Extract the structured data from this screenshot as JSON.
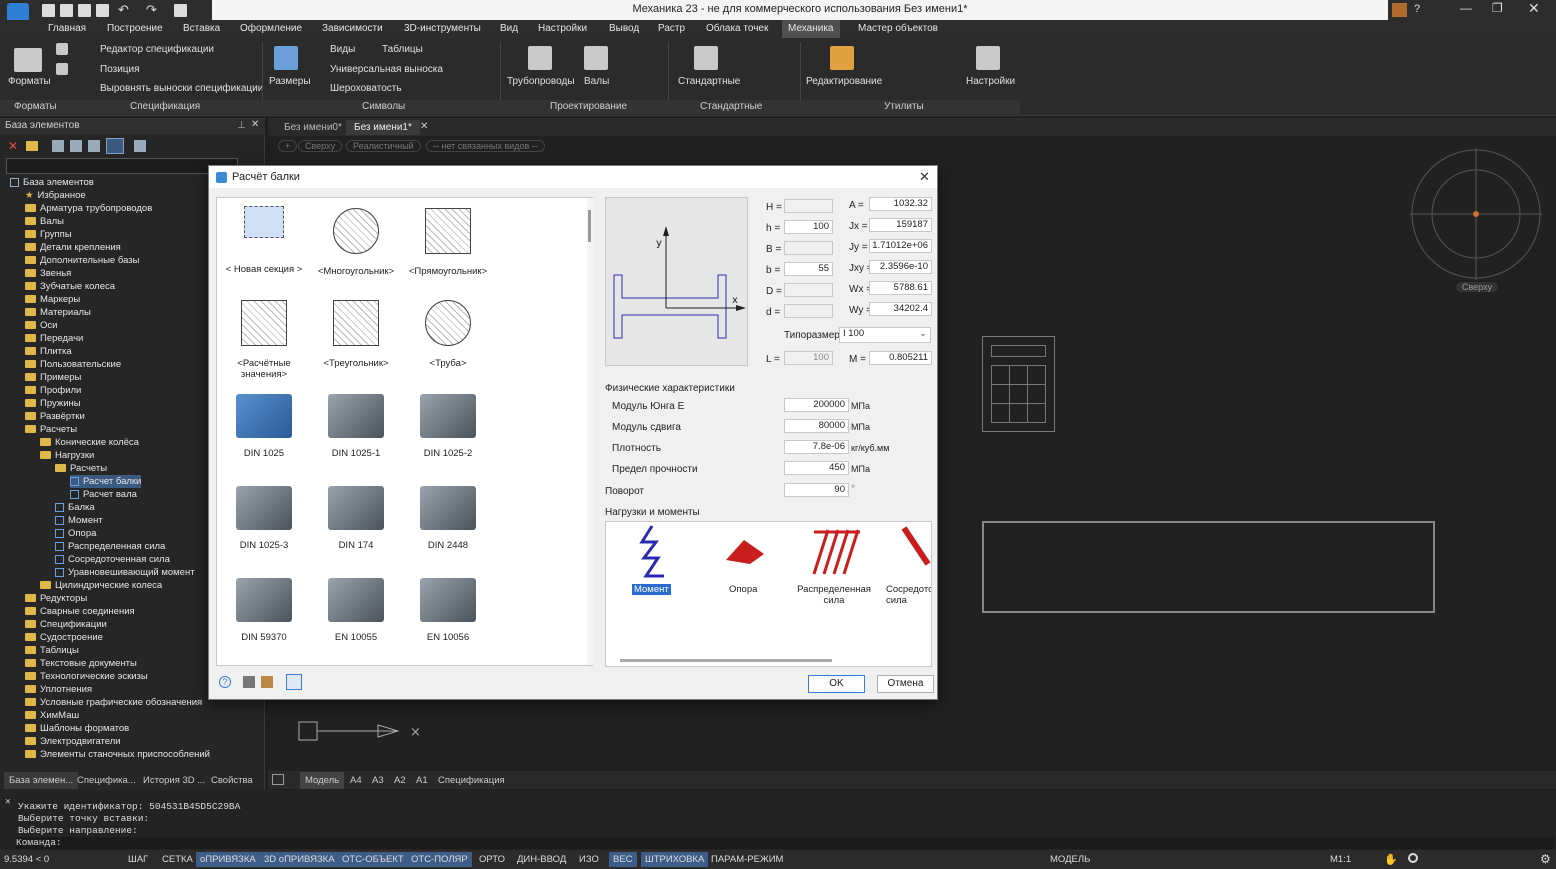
{
  "app": {
    "title": "Механика 23 - не для коммерческого использования Без имени1*"
  },
  "menu": [
    "Главная",
    "Построение",
    "Вставка",
    "Оформление",
    "Зависимости",
    "3D-инструменты",
    "Вид",
    "Настройки",
    "Вывод",
    "Растр",
    "Облака точек",
    "Механика",
    "Мастер объектов"
  ],
  "ribbon": {
    "formats": "Форматы",
    "spec_editor": "Редактор спецификации",
    "position": "Позиция",
    "align_spec": "Выровнять выноски спецификации",
    "sizes": "Размеры",
    "views": "Виды",
    "tables": "Таблицы",
    "universal_leader": "Универсальная выноска",
    "roughness": "Шероховатость",
    "pipelines": "Трубопроводы",
    "shafts": "Валы",
    "standard": "Стандартные",
    "editing": "Редактирование",
    "settings": "Настройки",
    "groups": [
      "Форматы",
      "Спецификация",
      "Символы",
      "Проектирование",
      "Стандартные",
      "Утилиты"
    ]
  },
  "left_panel": {
    "header": "База элементов",
    "tree": [
      {
        "label": "База элементов",
        "level": 0,
        "type": "root"
      },
      {
        "label": "Избранное",
        "level": 1,
        "type": "star"
      },
      {
        "label": "Арматура трубопроводов",
        "level": 1,
        "type": "folder"
      },
      {
        "label": "Валы",
        "level": 1,
        "type": "folder"
      },
      {
        "label": "Группы",
        "level": 1,
        "type": "folder"
      },
      {
        "label": "Детали крепления",
        "level": 1,
        "type": "folder"
      },
      {
        "label": "Дополнительные базы",
        "level": 1,
        "type": "folder"
      },
      {
        "label": "Звенья",
        "level": 1,
        "type": "folder"
      },
      {
        "label": "Зубчатые колеса",
        "level": 1,
        "type": "folder"
      },
      {
        "label": "Маркеры",
        "level": 1,
        "type": "folder"
      },
      {
        "label": "Материалы",
        "level": 1,
        "type": "folder"
      },
      {
        "label": "Оси",
        "level": 1,
        "type": "folder"
      },
      {
        "label": "Передачи",
        "level": 1,
        "type": "folder"
      },
      {
        "label": "Плитка",
        "level": 1,
        "type": "folder"
      },
      {
        "label": "Пользовательские",
        "level": 1,
        "type": "folder"
      },
      {
        "label": "Примеры",
        "level": 1,
        "type": "folder"
      },
      {
        "label": "Профили",
        "level": 1,
        "type": "folder"
      },
      {
        "label": "Пружины",
        "level": 1,
        "type": "folder"
      },
      {
        "label": "Развёртки",
        "level": 1,
        "type": "folder"
      },
      {
        "label": "Расчеты",
        "level": 1,
        "type": "folder"
      },
      {
        "label": "Конические колёса",
        "level": 2,
        "type": "folder"
      },
      {
        "label": "Нагрузки",
        "level": 2,
        "type": "folder"
      },
      {
        "label": "Расчеты",
        "level": 3,
        "type": "folder"
      },
      {
        "label": "Расчет балки",
        "level": 4,
        "type": "leaf",
        "selected": true
      },
      {
        "label": "Расчет вала",
        "level": 4,
        "type": "leaf"
      },
      {
        "label": "Балка",
        "level": 3,
        "type": "leaf"
      },
      {
        "label": "Момент",
        "level": 3,
        "type": "leaf"
      },
      {
        "label": "Опора",
        "level": 3,
        "type": "leaf"
      },
      {
        "label": "Распределенная сила",
        "level": 3,
        "type": "leaf"
      },
      {
        "label": "Сосредоточенная сила",
        "level": 3,
        "type": "leaf"
      },
      {
        "label": "Уравновешивающий момент",
        "level": 3,
        "type": "leaf"
      },
      {
        "label": "Цилиндрические колеса",
        "level": 2,
        "type": "folder"
      },
      {
        "label": "Редукторы",
        "level": 1,
        "type": "folder"
      },
      {
        "label": "Сварные соединения",
        "level": 1,
        "type": "folder"
      },
      {
        "label": "Спецификации",
        "level": 1,
        "type": "folder"
      },
      {
        "label": "Судостроение",
        "level": 1,
        "type": "folder"
      },
      {
        "label": "Таблицы",
        "level": 1,
        "type": "folder"
      },
      {
        "label": "Текстовые документы",
        "level": 1,
        "type": "folder"
      },
      {
        "label": "Технологические эскизы",
        "level": 1,
        "type": "folder"
      },
      {
        "label": "Уплотнения",
        "level": 1,
        "type": "folder"
      },
      {
        "label": "Условные графические обозначения",
        "level": 1,
        "type": "folder"
      },
      {
        "label": "ХимМаш",
        "level": 1,
        "type": "folder"
      },
      {
        "label": "Шаблоны форматов",
        "level": 1,
        "type": "folder"
      },
      {
        "label": "Электродвигатели",
        "level": 1,
        "type": "folder"
      },
      {
        "label": "Элементы станочных приспособлений",
        "level": 1,
        "type": "folder"
      }
    ],
    "bottom_tabs": [
      "База элемен...",
      "Специфика...",
      "История 3D ...",
      "Свойства"
    ]
  },
  "doc_tabs": [
    "Без имени0*",
    "Без имени1*"
  ],
  "viewport": {
    "buttons": [
      "+",
      "Сверху",
      "Реалистичный",
      "-- нет связанных видов --"
    ],
    "compass_label": "Сверху"
  },
  "layout_tabs": [
    "Модель",
    "A4",
    "A3",
    "A2",
    "A1",
    "Спецификация"
  ],
  "dialog": {
    "title": "Расчёт балки",
    "gallery": [
      "< Новая секция >",
      "<Многоугольник>",
      "<Прямоугольник>",
      "<Расчётные значения>",
      "<Треугольник>",
      "<Труба>",
      "DIN 1025",
      "DIN 1025-1",
      "DIN 1025-2",
      "DIN 1025-3",
      "DIN 174",
      "DIN 2448",
      "DIN 59370",
      "EN 10055",
      "EN 10056"
    ],
    "left_params": [
      {
        "label": "H =",
        "value": ""
      },
      {
        "label": "h =",
        "value": "100"
      },
      {
        "label": "B =",
        "value": ""
      },
      {
        "label": "b =",
        "value": "55"
      },
      {
        "label": "D =",
        "value": ""
      },
      {
        "label": "d =",
        "value": ""
      }
    ],
    "right_params": [
      {
        "label": "A =",
        "value": "1032.32"
      },
      {
        "label": "Jx =",
        "value": "159187"
      },
      {
        "label": "Jy =",
        "value": "1.71012e+06"
      },
      {
        "label": "Jxy =",
        "value": "2.3596e-10"
      },
      {
        "label": "Wx =",
        "value": "5788.61"
      },
      {
        "label": "Wy =",
        "value": "34202.4"
      }
    ],
    "typesize_label": "Типоразмер",
    "typesize_value": "I 100",
    "L_label": "L =",
    "L_value": "100",
    "M_label": "M =",
    "M_value": "0.805211",
    "phys_title": "Физические характеристики",
    "phys": [
      {
        "label": "Модуль Юнга Е",
        "value": "200000",
        "unit": "МПа"
      },
      {
        "label": "Модуль сдвига",
        "value": "80000",
        "unit": "МПа"
      },
      {
        "label": "Плотность",
        "value": "7.8e-06",
        "unit": "кг/куб.мм"
      },
      {
        "label": "Предел прочности",
        "value": "450",
        "unit": "МПа"
      }
    ],
    "rotation_label": "Поворот",
    "rotation_value": "90",
    "rotation_unit": "°",
    "loads_title": "Нагрузки и моменты",
    "loads": [
      "Момент",
      "Опора",
      "Распределенная сила",
      "Сосредоточенная сила"
    ],
    "ok": "OK",
    "cancel": "Отмена"
  },
  "command": {
    "lines": [
      "Укажите идентификатор: 504531B45D5C29BA",
      "Выберите точку вставки:",
      "Выберите направление:"
    ],
    "prompt": "Команда:"
  },
  "status": {
    "coords": "9.5394 < 0",
    "toggles": [
      {
        "label": "ШАГ",
        "on": false
      },
      {
        "label": "СЕТКА",
        "on": false
      },
      {
        "label": "оПРИВЯЗКА",
        "on": true
      },
      {
        "label": "3D оПРИВЯЗКА",
        "on": true
      },
      {
        "label": "ОТС-ОБЪЕКТ",
        "on": true
      },
      {
        "label": "ОТС-ПОЛЯР",
        "on": true
      },
      {
        "label": "ОРТО",
        "on": false
      },
      {
        "label": "ДИН-ВВОД",
        "on": false
      },
      {
        "label": "ИЗО",
        "on": false
      },
      {
        "label": "ВЕС",
        "on": true
      },
      {
        "label": "ШТРИХОВКА",
        "on": true
      },
      {
        "label": "ПАРАМ-РЕЖИМ",
        "on": false
      }
    ],
    "model": "МОДЕЛЬ",
    "scale": "M1:1"
  },
  "colors": {
    "accent": "#3d5d88",
    "selection": "#3a5a80",
    "folder": "#e0b84a"
  }
}
